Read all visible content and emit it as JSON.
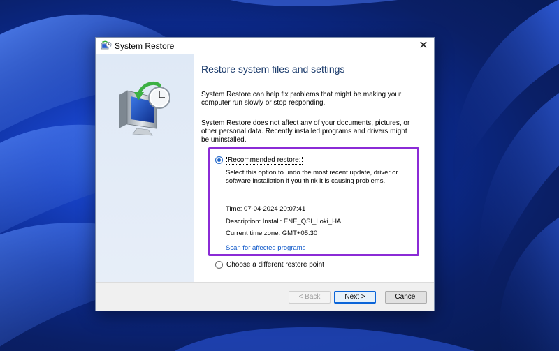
{
  "window": {
    "title": "System Restore",
    "close_glyph": "✕"
  },
  "heading": "Restore system files and settings",
  "paragraphs": {
    "intro": "System Restore can help fix problems that might be making your computer run slowly or stop responding.",
    "notice": "System Restore does not affect any of your documents, pictures, or other personal data. Recently installed programs and drivers might be uninstalled."
  },
  "options": {
    "recommended": {
      "label": "Recommended restore:",
      "selected": true,
      "description": "Select this option to undo the most recent update, driver or software installation if you think it is causing problems.",
      "time": "Time: 07-04-2024 20:07:41",
      "restore_description": "Description: Install: ENE_QSI_Loki_HAL",
      "timezone": "Current time zone: GMT+05:30",
      "scan_link": "Scan for affected programs"
    },
    "different": {
      "label": "Choose a different restore point",
      "selected": false
    }
  },
  "buttons": {
    "back": "< Back",
    "next": "Next >",
    "cancel": "Cancel"
  },
  "icons": {
    "title": "system-restore-icon",
    "illustration": "computer-restore-clock-icon"
  },
  "colors": {
    "highlight_border": "#8b2bd6",
    "link": "#0a55c8",
    "heading": "#1a3a6b",
    "accent": "#1e64c8"
  }
}
